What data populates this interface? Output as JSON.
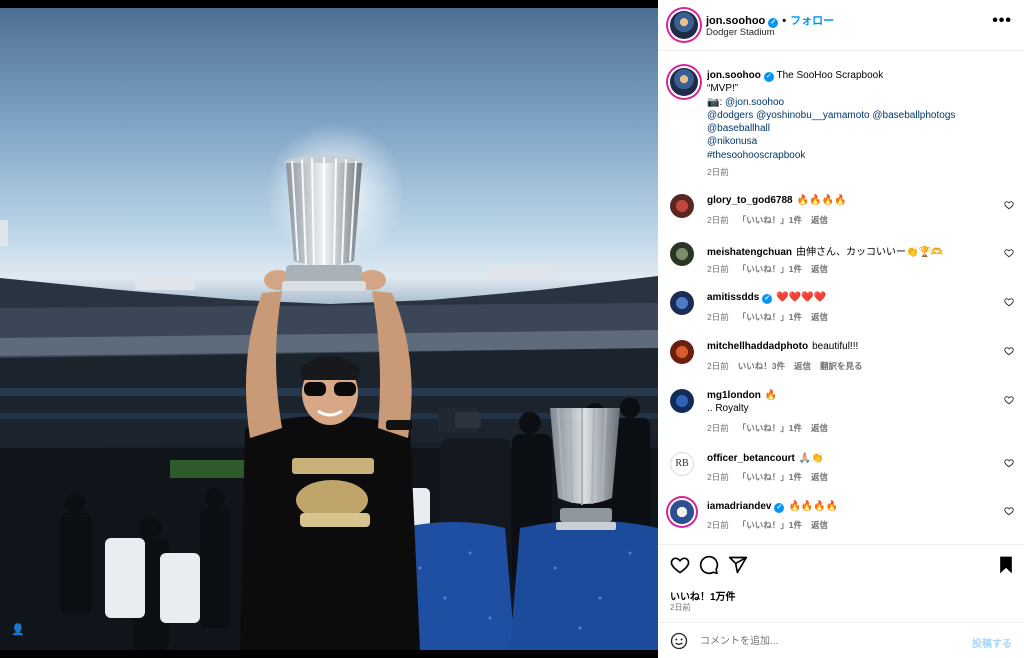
{
  "post": {
    "username": "jon.soohoo",
    "follow_label": "フォロー",
    "location": "Dodger Stadium",
    "more_icon": "more-horizontal-icon"
  },
  "caption": {
    "username": "jon.soohoo",
    "title": "The SooHoo Scrapbook",
    "quote": "“MVP!”",
    "camera_prefix": "📷: ",
    "camera_handle": "@jon.soohoo",
    "mentions_line1": "@dodgers @yoshinobu__yamamoto @baseballphotogs",
    "mentions_line2": "@baseballhall",
    "mentions_line3": "@nikonusa",
    "hashtag": "#thesoohooscrapbook",
    "time": "2日前"
  },
  "comments": [
    {
      "user": "glory_to_god6788",
      "verified": false,
      "text": "🔥🔥🔥🔥",
      "line2": "",
      "time": "2日前",
      "likes": "「いいね！」1件",
      "reply": "返信",
      "extra": ""
    },
    {
      "user": "meishatengchuan",
      "verified": false,
      "text": "由伸さん、カッコいいー👏🏆🫶",
      "line2": "",
      "time": "2日前",
      "likes": "「いいね！」1件",
      "reply": "返信",
      "extra": ""
    },
    {
      "user": "amitissdds",
      "verified": true,
      "text": "❤️❤️❤️❤️",
      "line2": "",
      "time": "2日前",
      "likes": "「いいね！」1件",
      "reply": "返信",
      "extra": ""
    },
    {
      "user": "mitchellhaddadphoto",
      "verified": false,
      "text": "beautiful!!!",
      "line2": "",
      "time": "2日前",
      "likes": "いいね！3件",
      "reply": "返信",
      "extra": "翻訳を見る"
    },
    {
      "user": "mg1london",
      "verified": false,
      "text": "🔥",
      "line2": ".. Royalty",
      "time": "2日前",
      "likes": "「いいね！」1件",
      "reply": "返信",
      "extra": ""
    },
    {
      "user": "officer_betancourt",
      "verified": false,
      "text": "🙏🏼👏",
      "line2": "",
      "time": "2日前",
      "likes": "「いいね！」1件",
      "reply": "返信",
      "extra": ""
    },
    {
      "user": "iamadriandev",
      "verified": true,
      "text": "🔥🔥🔥🔥",
      "line2": "",
      "time": "2日前",
      "likes": "「いいね！」1件",
      "reply": "返信",
      "extra": ""
    }
  ],
  "footer": {
    "likes_count": "いいね！1万件",
    "time": "2日前",
    "icons": [
      "heart-icon",
      "comment-icon",
      "share-icon",
      "bookmark-icon"
    ]
  },
  "add_comment": {
    "placeholder": "コメントを追加...",
    "post_label": "投稿する"
  },
  "colors": {
    "accent": "#0095f6",
    "link": "#00376b",
    "muted": "#737373"
  }
}
